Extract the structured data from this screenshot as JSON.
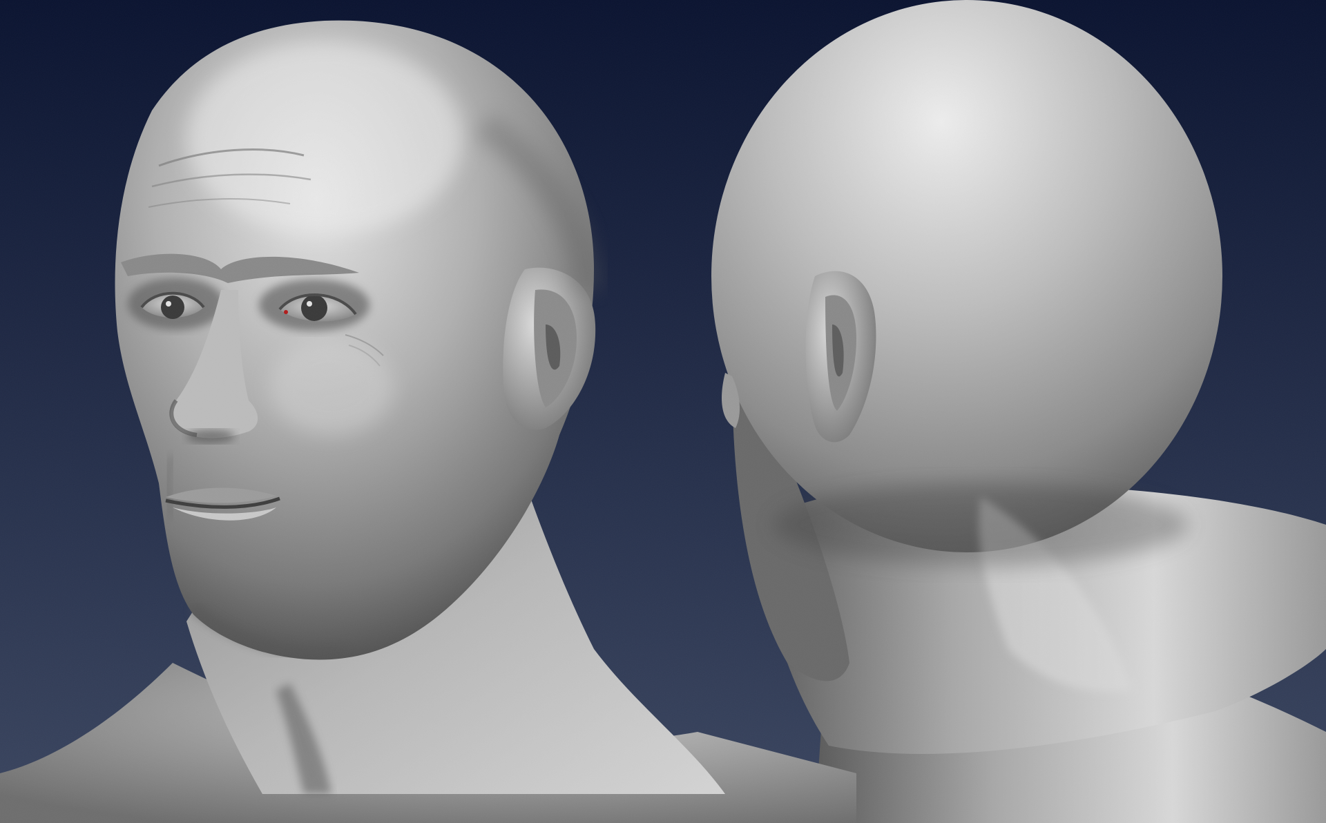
{
  "scene": {
    "background_top_color": "#0a1330",
    "background_bottom_color": "#3b4660",
    "clay_color": "#a6a6a6",
    "clay_highlight_color": "#ececec",
    "clay_shadow_color": "#3e3e3e",
    "eye_iris_color": "#3a3a3a",
    "eye_accent_color": "#b11b1b"
  },
  "views": [
    {
      "name": "front-three-quarter"
    },
    {
      "name": "back-three-quarter"
    }
  ]
}
